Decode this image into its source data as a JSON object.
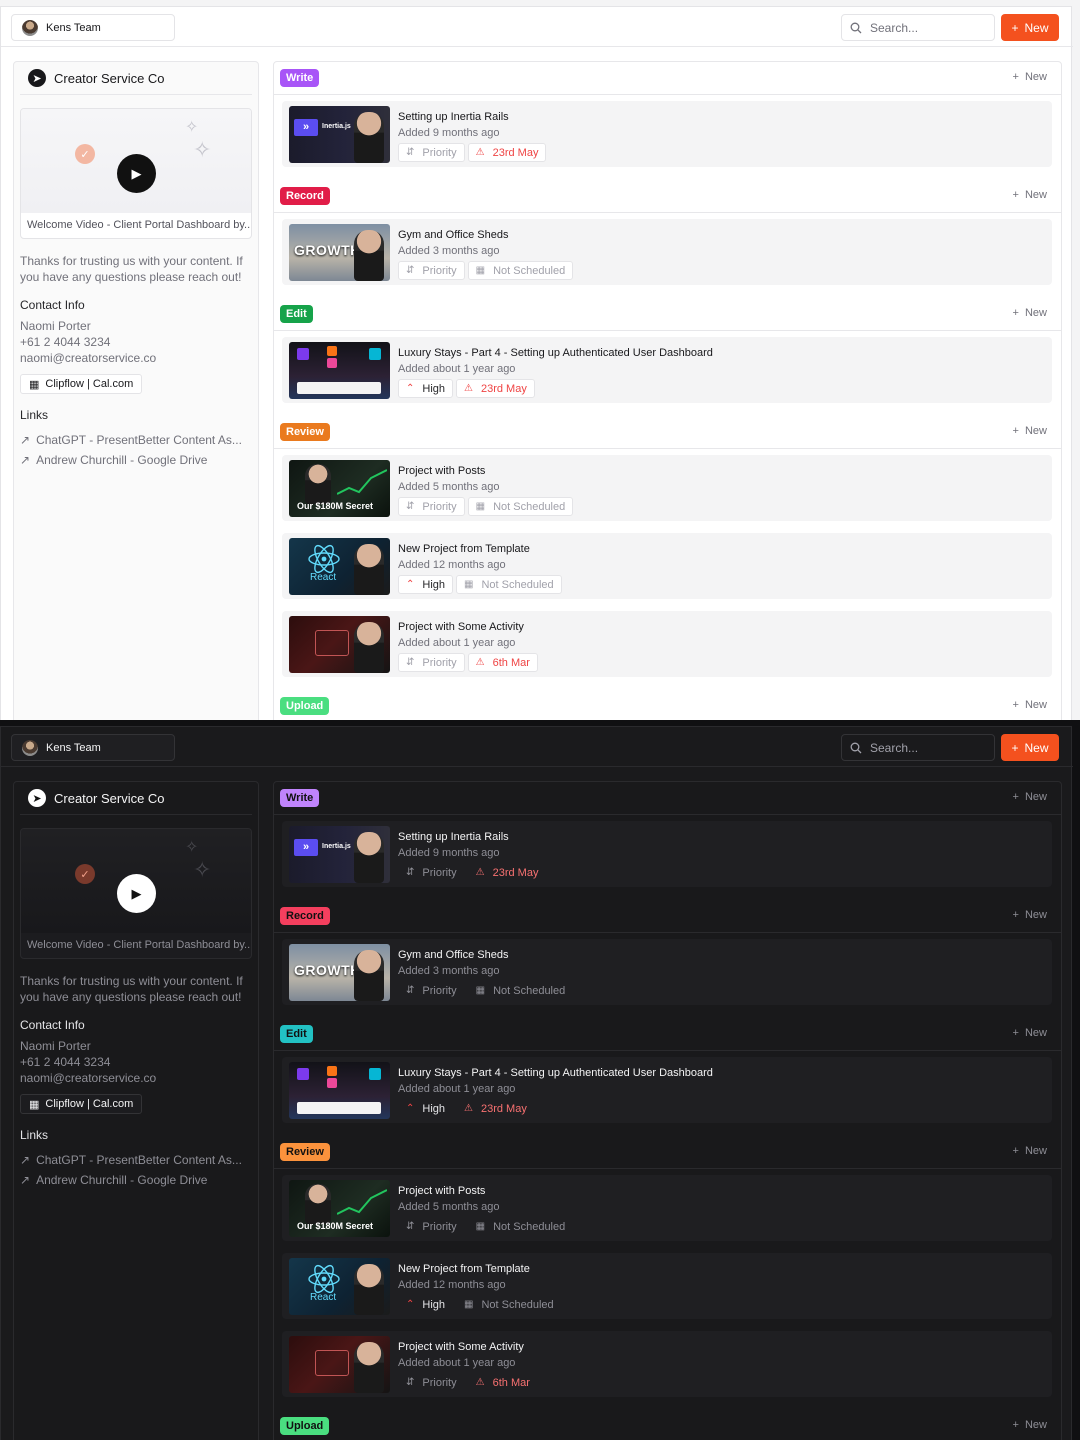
{
  "header": {
    "team_name": "Kens Team",
    "search_placeholder": "Search...",
    "new_label": "New"
  },
  "sidebar": {
    "client_name": "Creator Service Co",
    "video_caption": "Welcome Video - Client Portal Dashboard by...",
    "thanks_text": "Thanks for trusting us with your content. If you have any questions please reach out!",
    "contact_title": "Contact Info",
    "contact_name": "Naomi Porter",
    "contact_phone": "+61 2 4044 3234",
    "contact_email": "naomi@creatorservice.co",
    "calendar_label": "Clipflow | Cal.com",
    "links_title": "Links",
    "links": [
      "ChatGPT - PresentBetter Content As...",
      "Andrew Churchill - Google Drive"
    ]
  },
  "sections": [
    {
      "label": "Write",
      "color": "#a855f7",
      "new_label": "New"
    },
    {
      "label": "Record",
      "color": "#e11d48",
      "new_label": "New"
    },
    {
      "label": "Edit",
      "color": "#16a34a",
      "new_label": "New"
    },
    {
      "label": "Review",
      "color": "#ea7a1e",
      "new_label": "New"
    },
    {
      "label": "Upload",
      "color": "#4ade80",
      "new_label": "New"
    }
  ],
  "dark_section_colors": [
    "#c084fc",
    "#f43f5e",
    "#22c1c3",
    "#fb923c",
    "#4ade80"
  ],
  "cards": [
    {
      "title": "Setting up Inertia Rails",
      "added": "Added 9 months ago",
      "priority": "Priority",
      "date": "23rd May",
      "thumb_text": "Inertia.js"
    },
    {
      "title": "Gym and Office Sheds",
      "added": "Added 3 months ago",
      "priority": "Priority",
      "date": "Not Scheduled",
      "thumb_text": "GROWTH"
    },
    {
      "title": "Luxury Stays - Part 4 - Setting up Authenticated User Dashboard",
      "added": "Added about 1 year ago",
      "priority": "High",
      "date": "23rd May",
      "thumb_text": ""
    },
    {
      "title": "Project with Posts",
      "added": "Added 5 months ago",
      "priority": "Priority",
      "date": "Not Scheduled",
      "thumb_text": "Our $180M Secret"
    },
    {
      "title": "New Project from Template",
      "added": "Added 12 months ago",
      "priority": "High",
      "date": "Not Scheduled",
      "thumb_text": "React"
    },
    {
      "title": "Project with Some Activity",
      "added": "Added about 1 year ago",
      "priority": "Priority",
      "date": "6th Mar",
      "thumb_text": ""
    }
  ]
}
